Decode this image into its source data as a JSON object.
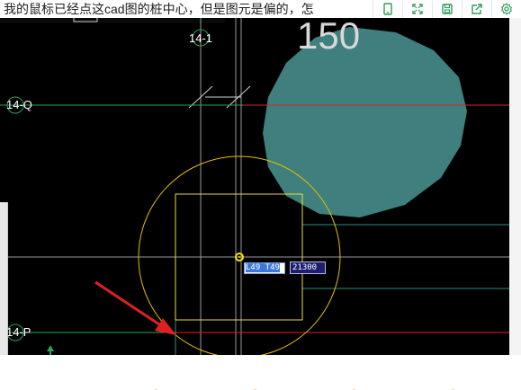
{
  "question": {
    "text": "我的鼠标已经点这cad图的桩中心，但是图元是偏的，怎"
  },
  "toolbar_icons": [
    "tablet-icon",
    "expand-icon",
    "save-icon",
    "share-icon",
    "settings-icon"
  ],
  "cad": {
    "big_number": "150",
    "axis_labels": {
      "top": "14-1",
      "left_upper": "14-Q",
      "left_lower": "14-P"
    },
    "dimension_input": "L49 T49",
    "dimension_value": "21300",
    "colors": {
      "background": "#000000",
      "column_fill": "#3f7f7d",
      "circle": "#e4c000",
      "square": "#e8dc3c",
      "red_line": "#e02020",
      "green_line": "#2ea35a",
      "arrow": "#e02020"
    }
  }
}
